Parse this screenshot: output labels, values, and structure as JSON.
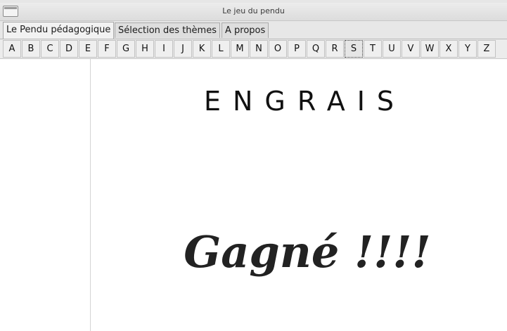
{
  "window": {
    "title": "Le jeu du pendu"
  },
  "tabs": [
    {
      "label": "Le Pendu pédagogique",
      "active": true
    },
    {
      "label": "Sélection des thèmes",
      "active": false
    },
    {
      "label": "A propos",
      "active": false
    }
  ],
  "letters": [
    "A",
    "B",
    "C",
    "D",
    "E",
    "F",
    "G",
    "H",
    "I",
    "J",
    "K",
    "L",
    "M",
    "N",
    "O",
    "P",
    "Q",
    "R",
    "S",
    "T",
    "U",
    "V",
    "W",
    "X",
    "Y",
    "Z"
  ],
  "focused_letter": "S",
  "game": {
    "word": "ENGRAIS",
    "result": "Gagné !!!!"
  }
}
